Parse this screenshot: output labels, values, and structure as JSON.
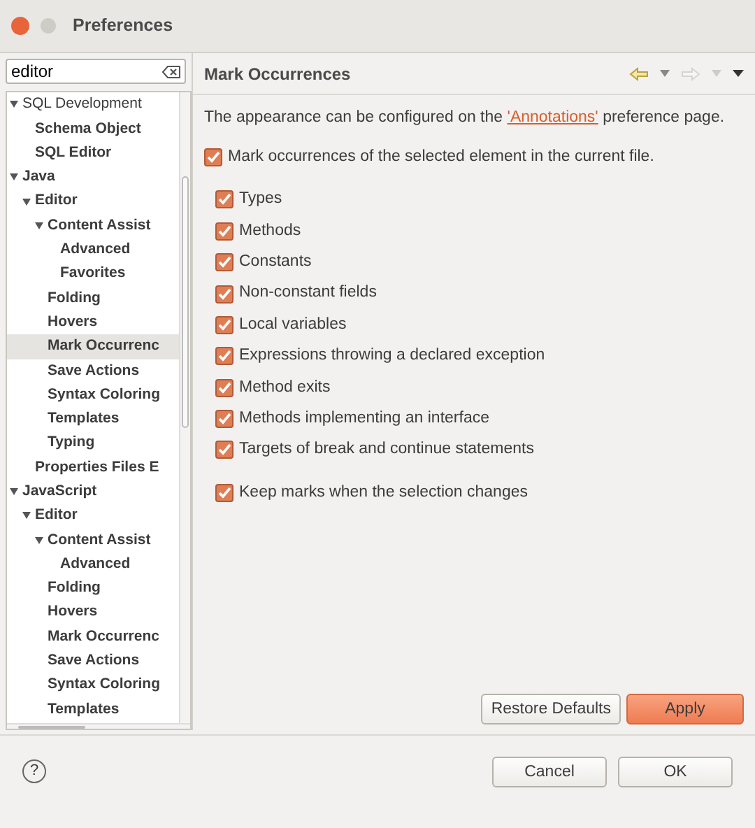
{
  "window": {
    "title": "Preferences"
  },
  "filter": {
    "value": "editor"
  },
  "tree": [
    {
      "label": "SQL Development",
      "matched": false,
      "selected": false,
      "expanded": true,
      "children": [
        {
          "label": "Schema Object",
          "matched": true,
          "selected": false
        },
        {
          "label": "SQL Editor",
          "matched": true,
          "selected": false
        }
      ]
    },
    {
      "label": "Java",
      "matched": true,
      "selected": false,
      "expanded": true,
      "children": [
        {
          "label": "Editor",
          "matched": true,
          "selected": false,
          "expanded": true,
          "children": [
            {
              "label": "Content Assist",
              "matched": true,
              "selected": false,
              "expanded": true,
              "children": [
                {
                  "label": "Advanced",
                  "matched": true,
                  "selected": false
                },
                {
                  "label": "Favorites",
                  "matched": true,
                  "selected": false
                }
              ]
            },
            {
              "label": "Folding",
              "matched": true,
              "selected": false
            },
            {
              "label": "Hovers",
              "matched": true,
              "selected": false
            },
            {
              "label": "Mark Occurrenc",
              "matched": true,
              "selected": true
            },
            {
              "label": "Save Actions",
              "matched": true,
              "selected": false
            },
            {
              "label": "Syntax Coloring",
              "matched": true,
              "selected": false
            },
            {
              "label": "Templates",
              "matched": true,
              "selected": false
            },
            {
              "label": "Typing",
              "matched": true,
              "selected": false
            }
          ]
        },
        {
          "label": "Properties Files E",
          "matched": true,
          "selected": false
        }
      ]
    },
    {
      "label": "JavaScript",
      "matched": true,
      "selected": false,
      "expanded": true,
      "children": [
        {
          "label": "Editor",
          "matched": true,
          "selected": false,
          "expanded": true,
          "children": [
            {
              "label": "Content Assist",
              "matched": true,
              "selected": false,
              "expanded": true,
              "children": [
                {
                  "label": "Advanced",
                  "matched": true,
                  "selected": false
                }
              ]
            },
            {
              "label": "Folding",
              "matched": true,
              "selected": false
            },
            {
              "label": "Hovers",
              "matched": true,
              "selected": false
            },
            {
              "label": "Mark Occurrenc",
              "matched": true,
              "selected": false
            },
            {
              "label": "Save Actions",
              "matched": true,
              "selected": false
            },
            {
              "label": "Syntax Coloring",
              "matched": true,
              "selected": false
            },
            {
              "label": "Templates",
              "matched": true,
              "selected": false
            }
          ]
        }
      ]
    }
  ],
  "page": {
    "title": "Mark Occurrences",
    "intro": {
      "before": "The appearance can be configured on the",
      "link": "'Annotations'",
      "after": "preference page."
    },
    "master": {
      "label": "Mark occurrences of the selected element in the current file.",
      "checked": true
    },
    "options": [
      {
        "label": "Types",
        "checked": true
      },
      {
        "label": "Methods",
        "checked": true
      },
      {
        "label": "Constants",
        "checked": true
      },
      {
        "label": "Non-constant fields",
        "checked": true
      },
      {
        "label": "Local variables",
        "checked": true
      },
      {
        "label": "Expressions throwing a declared exception",
        "checked": true
      },
      {
        "label": "Method exits",
        "checked": true
      },
      {
        "label": "Methods implementing an interface",
        "checked": true
      },
      {
        "label": "Targets of break and continue statements",
        "checked": true
      }
    ],
    "keep": {
      "label": "Keep marks when the selection changes",
      "checked": true
    },
    "buttons": [
      {
        "label": "Restore Defaults",
        "kind": "normal"
      },
      {
        "label": "Apply",
        "kind": "primary"
      }
    ]
  },
  "help": {
    "label": "?"
  },
  "dialog_buttons": [
    {
      "label": "Cancel",
      "kind": "normal"
    },
    {
      "label": "OK",
      "kind": "normal"
    }
  ]
}
